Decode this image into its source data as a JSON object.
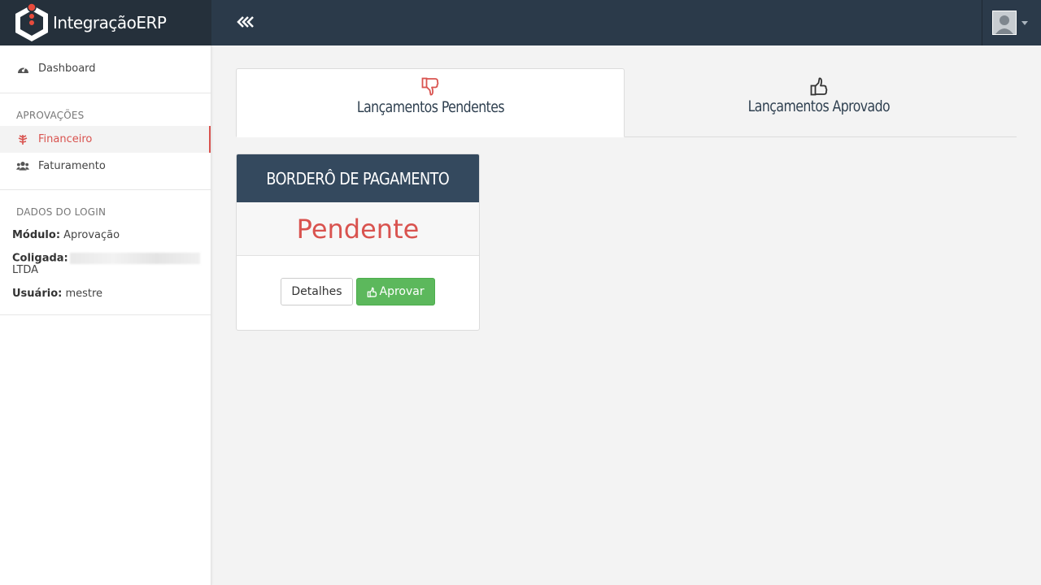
{
  "header": {
    "brand": "IntegraçãoERP",
    "collapse_label": "«",
    "collapse_icon": "double-chevron-left-icon",
    "user_icon": "user-avatar-icon"
  },
  "sidebar": {
    "dashboard": {
      "label": "Dashboard",
      "icon": "dashboard-gauge-icon"
    },
    "approvals_heading": "APROVAÇÕES",
    "items": [
      {
        "label": "Financeiro",
        "icon": "leaf-icon",
        "active": true
      },
      {
        "label": "Faturamento",
        "icon": "users-icon",
        "active": false
      }
    ],
    "login": {
      "heading": "DADOS DO LOGIN",
      "module_label": "Módulo:",
      "module_value": "Aprovação",
      "company_label": "Coligada:",
      "company_value": "LTDA",
      "user_label": "Usuário:",
      "user_value": "mestre"
    }
  },
  "tabs": [
    {
      "label": "Lançamentos Pendentes",
      "icon": "thumbs-down-icon",
      "active": true,
      "icon_color": "#d9534f"
    },
    {
      "label": "Lançamentos Aprovado",
      "icon": "thumbs-up-icon",
      "active": false,
      "icon_color": "#333333"
    }
  ],
  "card": {
    "title": "BORDERÔ DE PAGAMENTO",
    "status": "Pendente",
    "details_button": "Detalhes",
    "approve_button": "Aprovar"
  },
  "colors": {
    "header_bg": "#2b3a4a",
    "brand_bg": "#25303b",
    "accent_red": "#d9534f",
    "success_green": "#5cb85c",
    "card_head": "#34495e"
  }
}
